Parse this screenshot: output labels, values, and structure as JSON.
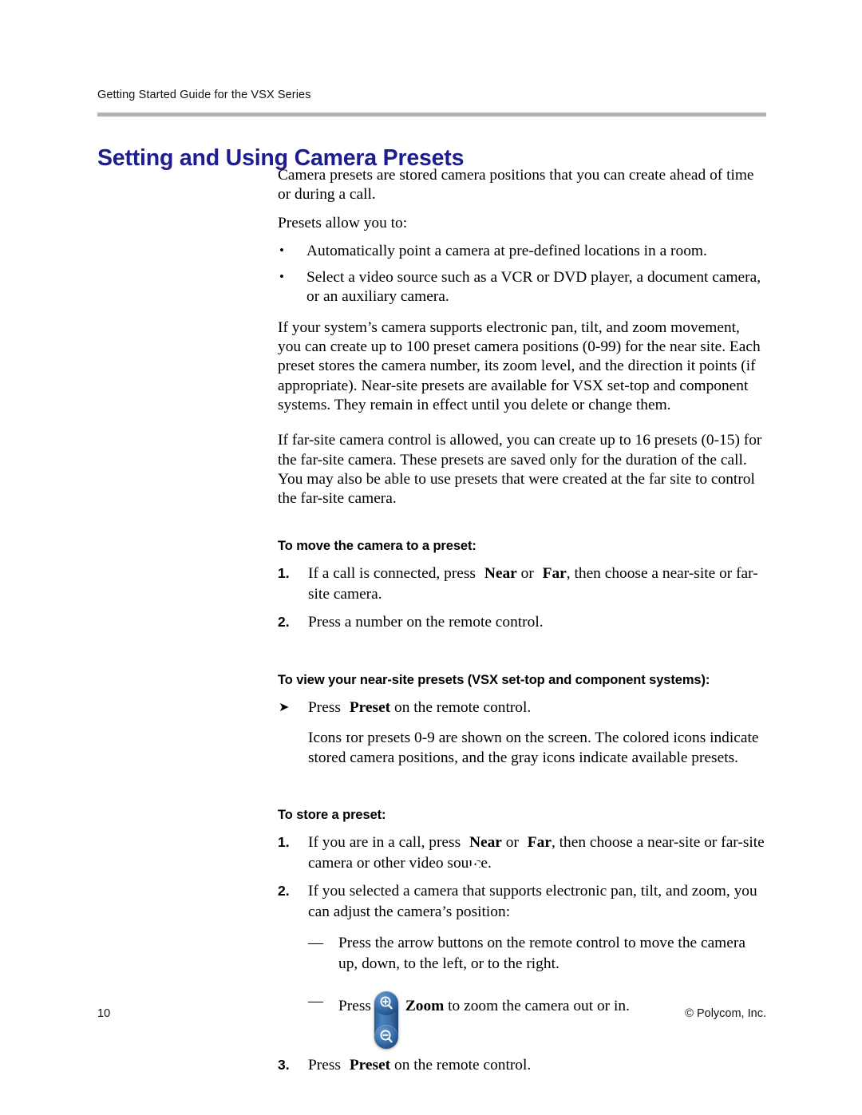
{
  "header": {
    "running_head": "Getting Started Guide for the VSX Series"
  },
  "title": "Setting and Using Camera Presets",
  "intro": {
    "para1": "Camera presets are stored camera positions that you can create ahead of time or during a call.",
    "para2": "Presets allow you to:",
    "bullets": [
      "Automatically point a camera at pre-defined locations in a room.",
      "Select a video source such as a VCR or DVD player, a document camera, or an auxiliary camera."
    ],
    "para3": "If your system’s camera supports electronic pan, tilt, and zoom movement, you can create up to 100 preset camera positions (0-99) for the near site. Each preset stores the camera number, its zoom level, and the direction it points (if appropriate). Near-site presets are available for VSX set-top and component systems. They remain in effect until you delete or change them.",
    "para4": "If far-site camera control is allowed, you can create up to 16 presets (0-15) for the far-site camera. These presets are saved only for the duration of the call. You may also be able to use presets that were created at the far site to control the far-site camera."
  },
  "section_move": {
    "heading": "To move the camera to a preset:",
    "step1": {
      "number": "1.",
      "text_before": "If a call is connected, press",
      "near_label": "Near",
      "conjunction": "or",
      "far_label": "Far",
      "text_after": ", then choose a near-site or far-site camera."
    },
    "step2": {
      "number": "2.",
      "text": "Press a number on the remote control."
    }
  },
  "section_view": {
    "heading": "To view your near-site presets (VSX set-top and component systems):",
    "arrow_step": {
      "marker": "➤",
      "text_before": "Press",
      "preset_label": "Preset",
      "text_after": "on the remote control."
    },
    "note": "Icons for presets 0-9 are shown on the screen. The colored icons indicate stored camera positions, and the gray icons indicate available presets."
  },
  "section_store": {
    "heading": "To store a preset:",
    "step1": {
      "number": "1.",
      "text_before": "If you are in a call, press",
      "near_label": "Near",
      "conjunction": "or",
      "far_label": "Far",
      "text_after": ", then choose a near-site or far-site camera or other video source."
    },
    "step2": {
      "number": "2.",
      "text": "If you selected a camera that supports electronic pan, tilt, and zoom, you can adjust the camera’s position:"
    },
    "substep1": {
      "marker": "—",
      "text": "Press the arrow buttons on the remote control to move the camera up, down, to the left, or to the right."
    },
    "substep2": {
      "marker": "—",
      "text_before": "Press",
      "zoom_label": "Zoom",
      "text_after": "to zoom the camera out or in."
    },
    "step3": {
      "number": "3.",
      "text_before": "Press",
      "preset_label": "Preset",
      "text_after": "on the remote control."
    }
  },
  "icons": {
    "near": "near-camera-icon",
    "far": "far-camera-icon",
    "preset": "preset-icon",
    "zoom_in": "zoom-in-icon",
    "zoom_out": "zoom-out-icon"
  },
  "colors": {
    "title": "#1d1d8f",
    "rule": "#b3b3b3",
    "button_blue": "#2f6aa4"
  },
  "footer": {
    "page_number": "10",
    "copyright": "© Polycom, Inc."
  }
}
